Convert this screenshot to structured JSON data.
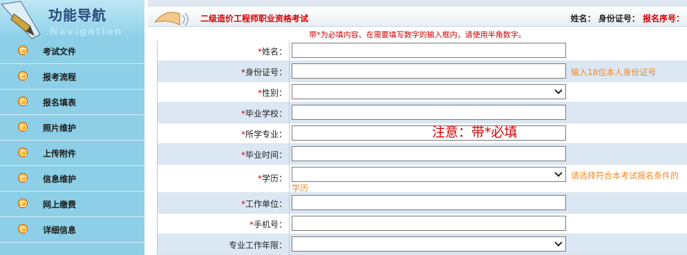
{
  "sidebar": {
    "title": "功能导航",
    "subtitle": "Navigation",
    "items": [
      {
        "label": "考试文件",
        "icon": "document-icon"
      },
      {
        "label": "报考流程",
        "icon": "document-icon"
      },
      {
        "label": "报名填表",
        "icon": "document-icon"
      },
      {
        "label": "照片维护",
        "icon": "document-icon"
      },
      {
        "label": "上传附件",
        "icon": "document-icon"
      },
      {
        "label": "信息维护",
        "icon": "document-icon"
      },
      {
        "label": "网上缴费",
        "icon": "document-icon"
      },
      {
        "label": "详细信息",
        "icon": "document-icon"
      }
    ]
  },
  "header": {
    "exam_title": "二级造价工程师职业资格考试",
    "name_label": "姓名：",
    "id_label": "身份证号：",
    "reg_label": "报名序号："
  },
  "notice": "带*为必填内容、在需要填写数字的输入框内，请使用半角数字。",
  "overlay_note": "注意：带*必填",
  "form": {
    "rows": [
      {
        "label": "姓名：",
        "required": "*",
        "type": "input",
        "hint": ""
      },
      {
        "label": "身份证号：",
        "required": "*",
        "type": "input",
        "hint": "输入18位本人身份证号"
      },
      {
        "label": "性别：",
        "required": "*",
        "type": "select",
        "hint": ""
      },
      {
        "label": "毕业学校：",
        "required": "*",
        "type": "input",
        "hint": ""
      },
      {
        "label": "所学专业：",
        "required": "*",
        "type": "input",
        "hint": ""
      },
      {
        "label": "毕业时间：",
        "required": "*",
        "type": "input",
        "hint": ""
      },
      {
        "label": "学历：",
        "required": "*",
        "type": "select",
        "hint": "请选择符合本考试报名条件的",
        "hint2": "学历"
      },
      {
        "label": "工作单位：",
        "required": "*",
        "type": "input",
        "hint": ""
      },
      {
        "label": "手机号：",
        "required": "*",
        "type": "input",
        "hint": ""
      },
      {
        "label": "专业工作年限：",
        "required": "",
        "type": "select",
        "hint": ""
      }
    ]
  },
  "colors": {
    "sidebar_bg": "#8ccfe6",
    "accent_red": "#d40000",
    "hint_orange": "#f08a2a",
    "row_alt": "#dbe7f3"
  }
}
